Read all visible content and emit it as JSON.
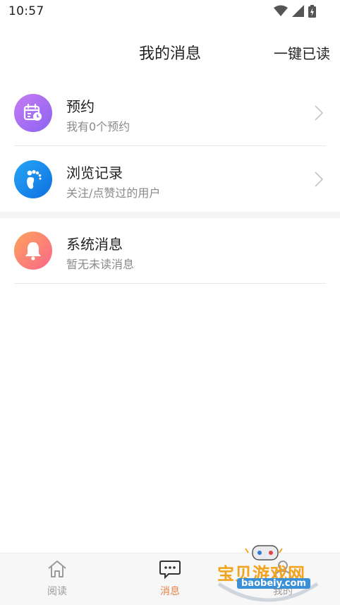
{
  "status_bar": {
    "time": "10:57"
  },
  "header": {
    "title": "我的消息",
    "mark_all_read": "一键已读"
  },
  "messages": [
    {
      "title": "预约",
      "subtitle": "我有0个预约",
      "icon": "calendar-clock-icon",
      "color": "#b070f0"
    },
    {
      "title": "浏览记录",
      "subtitle": "关注/点赞过的用户",
      "icon": "footprint-icon",
      "color": "#1a8cf0"
    },
    {
      "title": "系统消息",
      "subtitle": "暂无未读消息",
      "icon": "bell-icon",
      "color": "#fa7a70"
    }
  ],
  "tabs": [
    {
      "label": "阅读",
      "icon": "home-icon",
      "active": false
    },
    {
      "label": "消息",
      "icon": "chat-icon",
      "active": true
    },
    {
      "label": "我的",
      "icon": "user-icon",
      "active": false
    }
  ],
  "watermark": {
    "text": "宝贝游戏网",
    "url": "baobeiy.com"
  },
  "colors": {
    "accent": "#e8824a",
    "divider": "#e6e6e6",
    "subtitle": "#8a8a8a"
  }
}
